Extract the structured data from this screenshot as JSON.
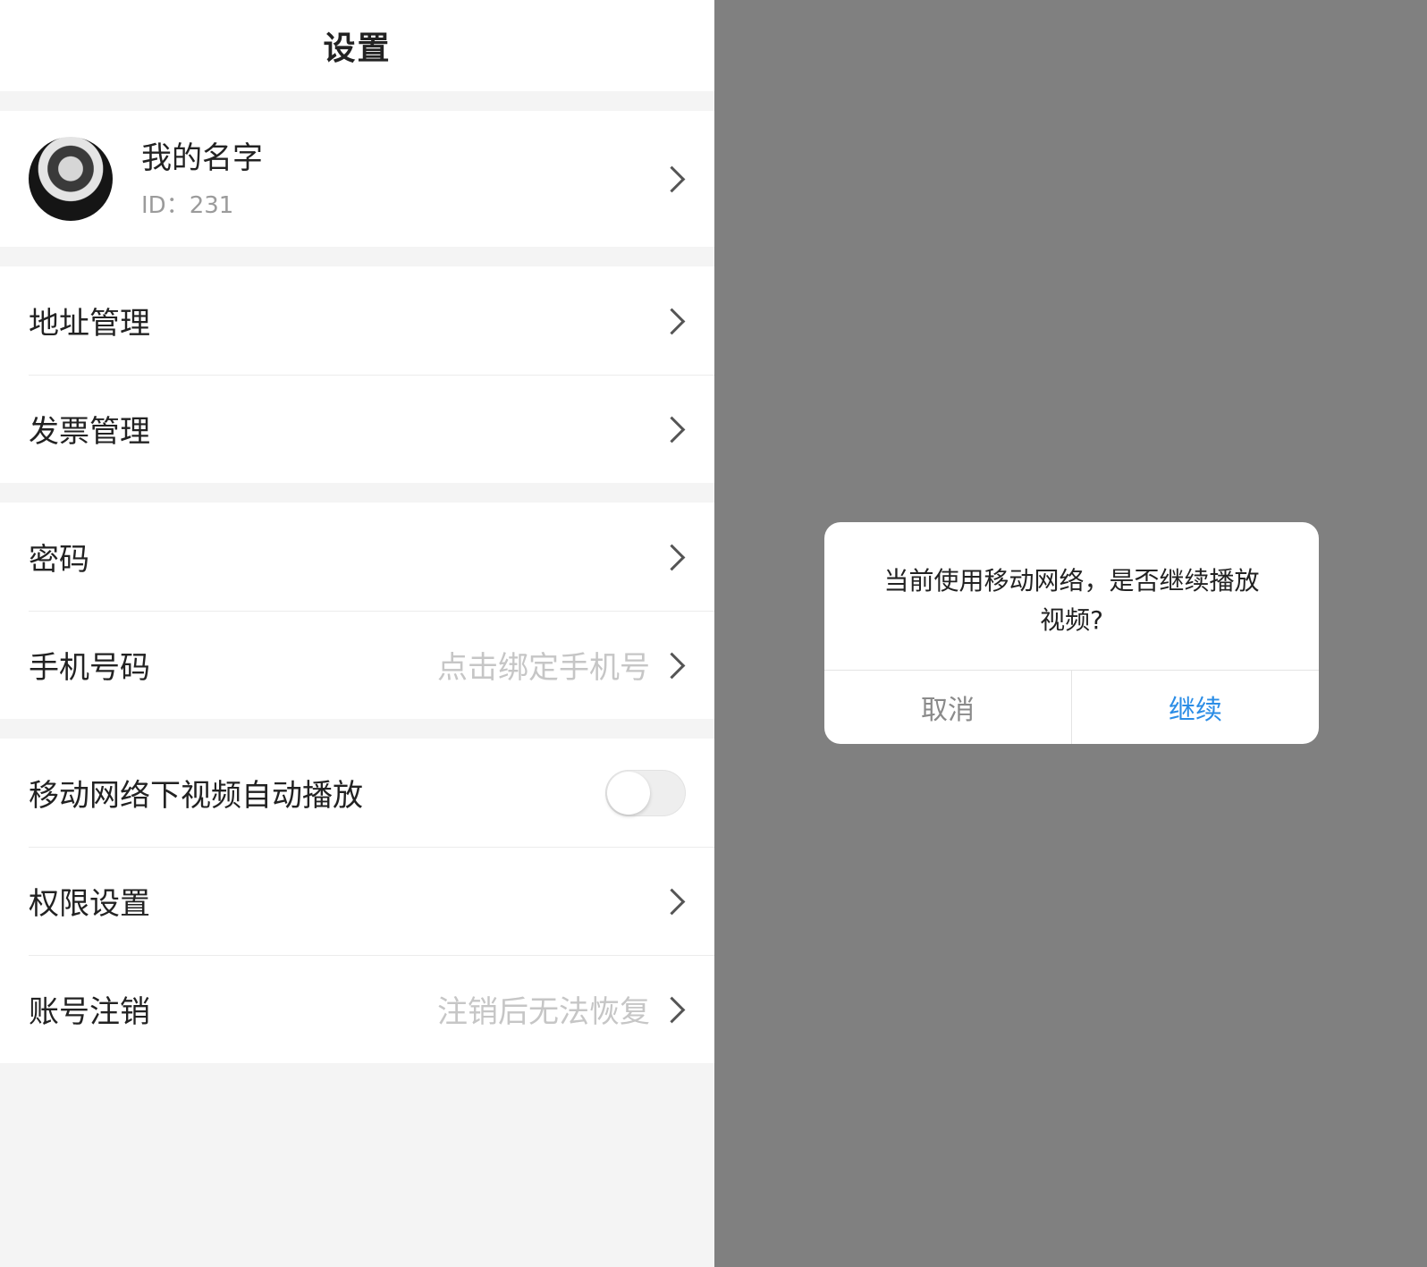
{
  "navbar": {
    "title": "设置"
  },
  "profile": {
    "name": "我的名字",
    "id_text": "ID：231"
  },
  "groups": [
    {
      "rows": [
        {
          "label": "地址管理"
        },
        {
          "label": "发票管理"
        }
      ]
    },
    {
      "rows": [
        {
          "label": "密码"
        },
        {
          "label": "手机号码",
          "value": "点击绑定手机号"
        }
      ]
    },
    {
      "rows": [
        {
          "label": "移动网络下视频自动播放",
          "toggle": false
        },
        {
          "label": "权限设置"
        },
        {
          "label": "账号注销",
          "value": "注销后无法恢复"
        }
      ]
    }
  ],
  "dialog": {
    "message": "当前使用移动网络，是否继续播放视频?",
    "cancel_label": "取消",
    "confirm_label": "继续"
  },
  "colors": {
    "accent": "#2b8de6",
    "overlay": "#808080",
    "background": "#f4f4f4"
  }
}
